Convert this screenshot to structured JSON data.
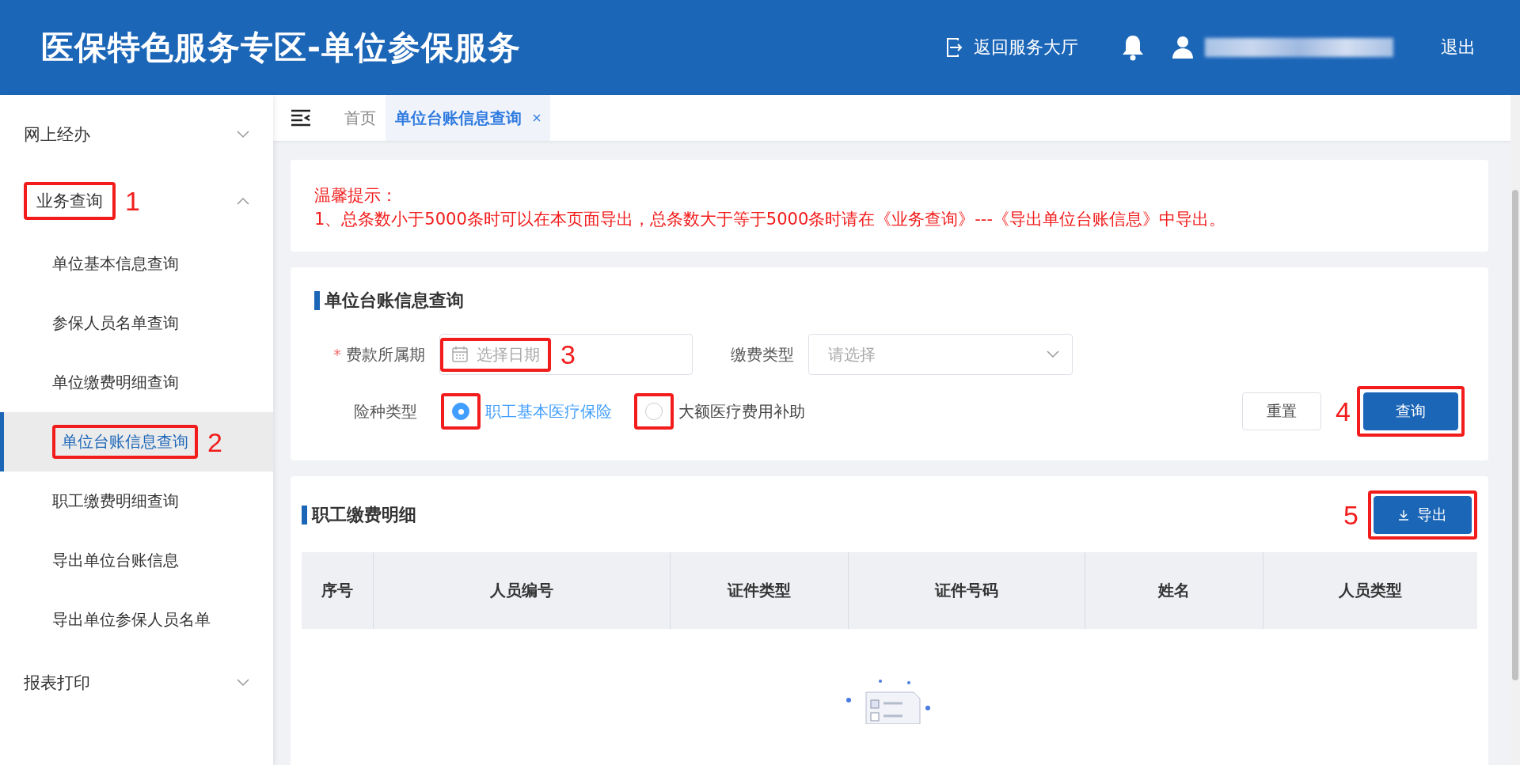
{
  "header": {
    "title": "医保特色服务专区-单位参保服务",
    "back_link": "返回服务大厅",
    "logout": "退出"
  },
  "sidebar": {
    "items": [
      {
        "label": "网上经办",
        "expanded": false
      },
      {
        "label": "业务查询",
        "expanded": true,
        "callout": "1",
        "children": [
          {
            "label": "单位基本信息查询",
            "selected": false
          },
          {
            "label": "参保人员名单查询",
            "selected": false
          },
          {
            "label": "单位缴费明细查询",
            "selected": false
          },
          {
            "label": "单位台账信息查询",
            "selected": true,
            "callout": "2"
          },
          {
            "label": "职工缴费明细查询",
            "selected": false
          },
          {
            "label": "导出单位台账信息",
            "selected": false
          },
          {
            "label": "导出单位参保人员名单",
            "selected": false
          }
        ]
      },
      {
        "label": "报表打印",
        "expanded": false
      }
    ]
  },
  "tabs": [
    {
      "label": "首页",
      "selected": false,
      "closable": false
    },
    {
      "label": "单位台账信息查询",
      "selected": true,
      "closable": true
    }
  ],
  "notice": {
    "title": "温馨提示：",
    "text": "1、总条数小于5000条时可以在本页面导出，总条数大于等于5000条时请在《业务查询》---《导出单位台账信息》中导出。"
  },
  "query": {
    "title": "单位台账信息查询",
    "period": {
      "label": "费款所属期",
      "required_mark": "*",
      "placeholder": "选择日期",
      "callout": "3"
    },
    "pay_type": {
      "label": "缴费类型",
      "placeholder": "请选择"
    },
    "insurance": {
      "label": "险种类型",
      "options": [
        {
          "label": "职工基本医疗保险",
          "selected": true,
          "boxed": true
        },
        {
          "label": "大额医疗费用补助",
          "selected": false,
          "boxed": true
        }
      ]
    },
    "reset": "重置",
    "submit": {
      "label": "查询",
      "callout": "4"
    }
  },
  "table": {
    "title": "职工缴费明细",
    "export": {
      "label": "导出",
      "callout": "5"
    },
    "columns": [
      "序号",
      "人员编号",
      "证件类型",
      "证件号码",
      "姓名",
      "人员类型"
    ]
  }
}
